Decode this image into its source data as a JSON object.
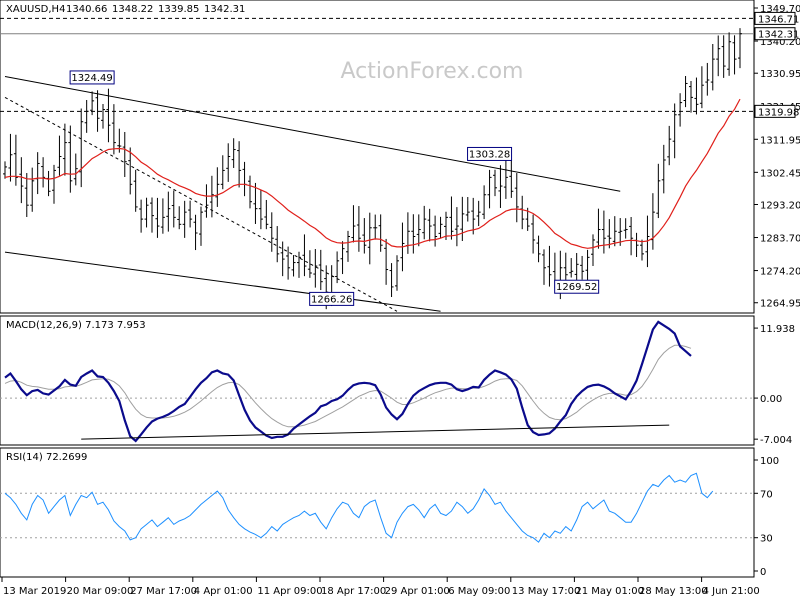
{
  "chart_data": [
    {
      "type": "candlestick",
      "panel": "price",
      "symbol": "XAUUSD,H4",
      "ohlc": [
        "1340.66",
        "1348.22",
        "1339.85",
        "1342.31"
      ],
      "watermark": "ActionForex.com",
      "ylim": [
        1262.0,
        1352.0
      ],
      "yticks": [
        "1349.70",
        "1340.20",
        "1330.95",
        "1321.45",
        "1311.95",
        "1302.45",
        "1293.20",
        "1283.70",
        "1274.20",
        "1264.95"
      ],
      "xticks": [
        "13 Mar 2019",
        "20 Mar 09:00",
        "27 Mar 17:00",
        "4 Apr 01:00",
        "11 Apr 09:00",
        "18 Apr 17:00",
        "29 Apr 01:00",
        "6 May 09:00",
        "13 May 17:00",
        "21 May 01:00",
        "28 May 13:00",
        "4 Jun 21:00"
      ],
      "level_lines": [
        {
          "value": 1346.71,
          "label": "1346.71",
          "style": "dashed"
        },
        {
          "value": 1342.31,
          "label": "1342.31",
          "style": "solid"
        },
        {
          "value": 1319.98,
          "label": "1319.98",
          "style": "dashed"
        }
      ],
      "annotations": [
        {
          "label": "1324.49",
          "bar": 16
        },
        {
          "label": "1266.26",
          "bar": 60
        },
        {
          "label": "1303.28",
          "bar": 89
        },
        {
          "label": "1269.52",
          "bar": 105
        }
      ],
      "trendlines": [
        {
          "name": "channel-upper",
          "from": [
            0,
            1330.0
          ],
          "to": [
            113,
            1297.0
          ],
          "style": "solid"
        },
        {
          "name": "channel-lower",
          "from": [
            0,
            1279.5
          ],
          "to": [
            80,
            1262.5
          ],
          "style": "solid"
        },
        {
          "name": "diagonal-trend",
          "from": [
            0,
            1324.0
          ],
          "to": [
            72,
            1262.5
          ],
          "style": "dashed"
        }
      ],
      "close": [
        1304.0,
        1307.5,
        1301.0,
        1298.5,
        1293.0,
        1300.0,
        1305.0,
        1301.0,
        1297.0,
        1303.0,
        1307.0,
        1311.0,
        1300.0,
        1303.5,
        1317.0,
        1320.0,
        1323.0,
        1318.0,
        1320.5,
        1316.0,
        1311.0,
        1310.0,
        1305.5,
        1299.0,
        1292.5,
        1289.0,
        1293.0,
        1290.0,
        1287.0,
        1289.5,
        1292.0,
        1289.5,
        1287.5,
        1291.0,
        1289.0,
        1285.0,
        1291.0,
        1293.0,
        1296.0,
        1299.0,
        1303.0,
        1307.0,
        1309.0,
        1303.0,
        1299.0,
        1294.0,
        1292.0,
        1289.0,
        1287.5,
        1283.5,
        1279.0,
        1277.5,
        1275.0,
        1276.5,
        1278.0,
        1275.5,
        1273.5,
        1275.5,
        1271.0,
        1268.0,
        1272.5,
        1277.0,
        1280.5,
        1284.0,
        1287.0,
        1283.5,
        1281.5,
        1286.5,
        1286.5,
        1281.5,
        1274.5,
        1269.5,
        1277.0,
        1282.0,
        1285.5,
        1284.0,
        1286.0,
        1289.0,
        1287.0,
        1284.0,
        1287.5,
        1289.5,
        1285.5,
        1287.0,
        1290.5,
        1291.0,
        1289.0,
        1291.0,
        1296.0,
        1301.0,
        1298.0,
        1298.5,
        1301.0,
        1297.0,
        1292.5,
        1289.0,
        1287.0,
        1283.0,
        1279.0,
        1275.0,
        1273.0,
        1271.0,
        1275.0,
        1273.0,
        1274.0,
        1276.0,
        1274.0,
        1278.0,
        1283.0,
        1286.0,
        1283.5,
        1283.5,
        1285.5,
        1285.5,
        1286.0,
        1283.5,
        1281.5,
        1279.0,
        1284.0,
        1291.0,
        1300.0,
        1306.0,
        1312.0,
        1319.0,
        1322.5,
        1328.0,
        1324.0,
        1322.0,
        1327.5,
        1329.0,
        1335.0,
        1338.0,
        1333.0,
        1340.0,
        1335.0,
        1342.3
      ],
      "ma": [
        1301.0,
        1301.3,
        1301.3,
        1301.1,
        1300.6,
        1300.5,
        1300.8,
        1300.8,
        1300.5,
        1300.7,
        1301.3,
        1302.1,
        1301.9,
        1302.0,
        1303.4,
        1304.9,
        1306.4,
        1307.3,
        1308.3,
        1309.0,
        1309.2,
        1309.3,
        1309.1,
        1308.2,
        1306.9,
        1305.4,
        1304.4,
        1303.2,
        1301.9,
        1301.0,
        1300.3,
        1299.4,
        1298.6,
        1298.0,
        1297.3,
        1296.4,
        1295.9,
        1295.6,
        1295.6,
        1295.9,
        1296.6,
        1297.6,
        1298.6,
        1299.0,
        1299.0,
        1298.6,
        1298.1,
        1297.4,
        1296.7,
        1295.6,
        1294.3,
        1293.0,
        1291.6,
        1290.5,
        1289.5,
        1288.4,
        1287.2,
        1286.3,
        1285.0,
        1283.6,
        1282.7,
        1282.2,
        1282.1,
        1282.2,
        1282.6,
        1282.7,
        1282.6,
        1283.0,
        1283.3,
        1283.2,
        1282.4,
        1281.3,
        1281.0,
        1281.0,
        1281.4,
        1281.6,
        1282.0,
        1282.6,
        1283.0,
        1283.1,
        1283.5,
        1284.1,
        1284.2,
        1284.4,
        1285.0,
        1285.6,
        1285.9,
        1286.3,
        1287.3,
        1288.6,
        1289.5,
        1290.3,
        1291.3,
        1291.8,
        1291.9,
        1291.7,
        1291.3,
        1290.6,
        1289.5,
        1288.1,
        1286.6,
        1284.9,
        1283.9,
        1282.8,
        1281.8,
        1281.4,
        1280.9,
        1280.6,
        1280.8,
        1281.3,
        1281.5,
        1281.7,
        1282.1,
        1282.4,
        1282.8,
        1282.9,
        1282.8,
        1282.5,
        1282.7,
        1283.5,
        1285.1,
        1287.1,
        1289.4,
        1292.4,
        1295.3,
        1298.5,
        1300.9,
        1303.0,
        1305.5,
        1307.9,
        1310.8,
        1313.7,
        1315.8,
        1318.6,
        1320.6,
        1323.5
      ]
    },
    {
      "type": "line",
      "panel": "macd",
      "label": "MACD(12,26,9) 7.173 7.953",
      "yticks": [
        "11.938",
        "0.00",
        "-7.004"
      ],
      "ylim": [
        -8.0,
        14.0
      ],
      "trendline": {
        "from": [
          14,
          -7.0
        ],
        "to": [
          122,
          -4.6
        ]
      },
      "series": [
        {
          "name": "MACD",
          "values": [
            3.5,
            4.2,
            2.9,
            1.5,
            0.5,
            1.2,
            1.4,
            0.8,
            0.6,
            1.3,
            2.0,
            3.1,
            2.3,
            2.1,
            3.6,
            4.2,
            4.7,
            3.7,
            3.6,
            2.6,
            1.2,
            -0.5,
            -3.8,
            -6.5,
            -7.3,
            -6.2,
            -5.0,
            -4.0,
            -3.5,
            -3.2,
            -2.8,
            -2.2,
            -1.5,
            -1.0,
            0.2,
            1.5,
            2.6,
            3.4,
            4.4,
            4.7,
            4.2,
            4.0,
            3.0,
            0.5,
            -2.0,
            -3.8,
            -5.0,
            -5.7,
            -6.4,
            -6.8,
            -6.6,
            -6.6,
            -6.2,
            -5.2,
            -4.5,
            -3.8,
            -3.1,
            -2.5,
            -1.4,
            -1.1,
            -0.5,
            -0.2,
            0.4,
            1.4,
            2.2,
            2.5,
            2.6,
            2.5,
            2.2,
            0.6,
            -1.6,
            -2.8,
            -3.6,
            -2.7,
            -1.0,
            0.4,
            1.2,
            1.7,
            2.2,
            2.5,
            2.6,
            2.6,
            2.3,
            1.5,
            1.2,
            1.5,
            1.9,
            1.8,
            3.1,
            4.0,
            4.7,
            4.4,
            4.0,
            3.2,
            1.6,
            -1.6,
            -4.6,
            -5.8,
            -6.3,
            -6.2,
            -6.0,
            -5.2,
            -4.0,
            -2.9,
            -1.0,
            0.3,
            1.2,
            1.9,
            2.2,
            2.3,
            2.0,
            1.5,
            0.8,
            0.3,
            -0.2,
            1.2,
            3.0,
            5.8,
            8.7,
            11.7,
            13.0,
            12.4,
            11.8,
            11.0,
            8.8,
            8.0,
            7.2
          ]
        },
        {
          "name": "Signal",
          "values": [
            2.5,
            2.9,
            3.0,
            2.7,
            2.2,
            2.0,
            1.9,
            1.7,
            1.5,
            1.5,
            1.6,
            1.9,
            2.0,
            2.0,
            2.3,
            2.7,
            3.1,
            3.2,
            3.3,
            3.2,
            2.8,
            2.1,
            0.9,
            -0.6,
            -1.9,
            -2.8,
            -3.3,
            -3.4,
            -3.4,
            -3.4,
            -3.3,
            -3.1,
            -2.8,
            -2.4,
            -1.9,
            -1.2,
            -0.5,
            0.3,
            1.1,
            1.8,
            2.3,
            2.6,
            2.7,
            2.3,
            1.4,
            0.3,
            -0.8,
            -1.8,
            -2.7,
            -3.5,
            -4.1,
            -4.6,
            -4.9,
            -4.9,
            -4.8,
            -4.6,
            -4.3,
            -4.0,
            -3.5,
            -3.0,
            -2.5,
            -2.0,
            -1.5,
            -0.9,
            -0.3,
            0.3,
            0.7,
            1.1,
            1.3,
            1.2,
            0.6,
            0.0,
            -0.7,
            -1.1,
            -1.1,
            -0.8,
            -0.4,
            0.0,
            0.5,
            0.9,
            1.2,
            1.5,
            1.7,
            1.7,
            1.6,
            1.6,
            1.7,
            1.7,
            2.0,
            2.4,
            2.9,
            3.2,
            3.3,
            3.3,
            3.0,
            2.1,
            0.8,
            -0.5,
            -1.7,
            -2.6,
            -3.3,
            -3.6,
            -3.7,
            -3.5,
            -3.0,
            -2.4,
            -1.6,
            -0.9,
            -0.3,
            0.2,
            0.6,
            0.8,
            0.8,
            0.7,
            0.5,
            0.6,
            1.1,
            2.0,
            3.3,
            4.9,
            6.6,
            7.7,
            8.5,
            9.0,
            9.0,
            8.8,
            8.5
          ]
        }
      ]
    },
    {
      "type": "line",
      "panel": "rsi",
      "label": "RSI(14) 72.2699",
      "yticks": [
        "100",
        "70",
        "30",
        "0"
      ],
      "ylim": [
        0,
        100
      ],
      "levels": [
        70,
        30
      ],
      "series": [
        {
          "name": "RSI",
          "values": [
            70,
            66,
            60,
            52,
            46,
            60,
            68,
            64,
            52,
            58,
            64,
            68,
            50,
            60,
            68,
            66,
            71,
            60,
            62,
            55,
            45,
            40,
            36,
            28,
            30,
            38,
            42,
            46,
            40,
            44,
            48,
            42,
            45,
            47,
            50,
            55,
            60,
            64,
            68,
            72,
            66,
            55,
            48,
            42,
            38,
            35,
            33,
            30,
            34,
            40,
            36,
            42,
            45,
            48,
            50,
            54,
            50,
            52,
            44,
            38,
            48,
            56,
            62,
            60,
            52,
            48,
            58,
            62,
            64,
            48,
            34,
            30,
            44,
            52,
            58,
            60,
            55,
            48,
            56,
            60,
            52,
            50,
            54,
            62,
            58,
            52,
            56,
            64,
            74,
            68,
            60,
            62,
            54,
            48,
            42,
            36,
            32,
            30,
            26,
            34,
            30,
            36,
            34,
            40,
            36,
            46,
            58,
            62,
            56,
            60,
            64,
            54,
            52,
            48,
            44,
            44,
            52,
            62,
            72,
            78,
            76,
            82,
            86,
            80,
            82,
            80,
            86,
            88,
            70,
            66,
            72
          ]
        }
      ]
    }
  ]
}
